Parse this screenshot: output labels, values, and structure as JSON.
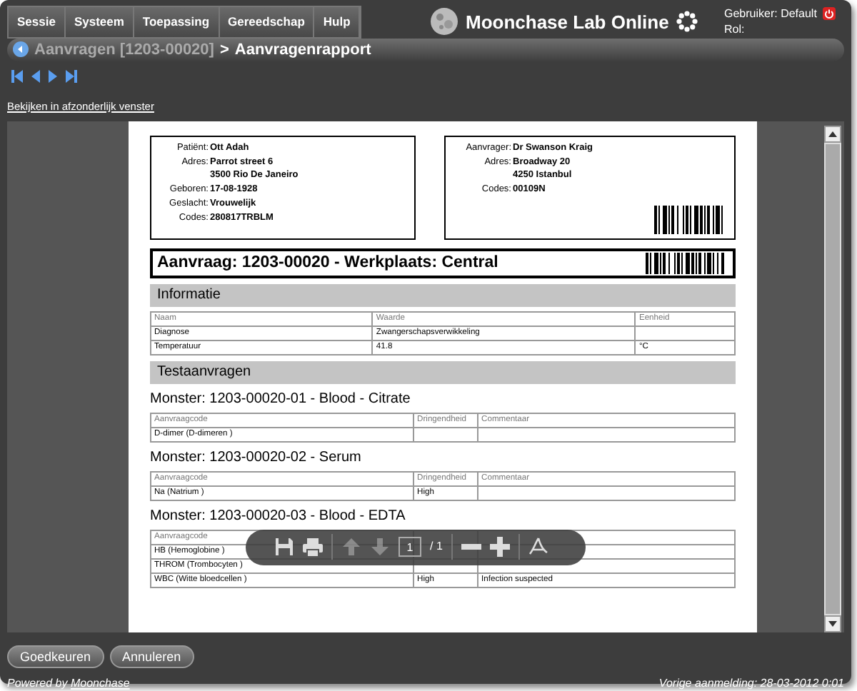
{
  "menu": [
    {
      "label": "Sessie"
    },
    {
      "label": "Systeem"
    },
    {
      "label": "Toepassing"
    },
    {
      "label": "Gereedschap"
    },
    {
      "label": "Hulp"
    }
  ],
  "app_title": "Moonchase Lab Online",
  "user": {
    "label": "Gebruiker:",
    "name": "Default",
    "role_label": "Rol:"
  },
  "breadcrumb": {
    "parent": "Aanvragen [1203-00020]",
    "separator": ">",
    "current": "Aanvragenrapport"
  },
  "open_link": "Bekijken in afzonderlijk venster",
  "report": {
    "patient": [
      {
        "label": "Patiënt:",
        "values": [
          "Ott Adah"
        ]
      },
      {
        "label": "Adres:",
        "values": [
          "Parrot street 6",
          "3500 Rio De Janeiro"
        ]
      },
      {
        "label": "Geboren:",
        "values": [
          "17-08-1928"
        ]
      },
      {
        "label": "Geslacht:",
        "values": [
          "Vrouwelijk"
        ]
      },
      {
        "label": "Codes:",
        "values": [
          "280817TRBLM"
        ]
      }
    ],
    "requester": [
      {
        "label": "Aanvrager:",
        "values": [
          "Dr Swanson Kraig"
        ]
      },
      {
        "label": "Adres:",
        "values": [
          "Broadway 20",
          "4250 Istanbul"
        ]
      },
      {
        "label": "Codes:",
        "values": [
          "00109N"
        ]
      }
    ],
    "title": "Aanvraag: 1203-00020 - Werkplaats: Central",
    "info": {
      "heading": "Informatie",
      "columns": [
        "Naam",
        "Waarde",
        "Eenheid"
      ],
      "rows": [
        [
          "Diagnose",
          "Zwangerschapsverwikkeling"
        ],
        [
          "Temperatuur",
          "41.8",
          "°C"
        ]
      ]
    },
    "tests_heading": "Testaanvragen",
    "samples": [
      {
        "title": "Monster: 1203-00020-01 - Blood - Citrate",
        "columns": [
          "Aanvraagcode",
          "Dringendheid",
          "Commentaar"
        ],
        "rows": [
          [
            "D-dimer (D-dimeren )"
          ]
        ]
      },
      {
        "title": "Monster: 1203-00020-02 - Serum",
        "columns": [
          "Aanvraagcode",
          "Dringendheid",
          "Commentaar"
        ],
        "rows": [
          [
            "Na (Natrium )",
            "High"
          ]
        ]
      },
      {
        "title": "Monster: 1203-00020-03 - Blood - EDTA",
        "columns": [
          "Aanvraagcode"
        ],
        "rows": [
          [
            "HB (Hemoglobine )"
          ],
          [
            "THROM (Trombocyten )"
          ],
          [
            "WBC (Witte bloedcellen )",
            "High",
            "Infection suspected"
          ]
        ]
      }
    ]
  },
  "viewer_toolbar": {
    "tools": [
      {
        "kind": "save",
        "disabled": false
      },
      {
        "kind": "print",
        "disabled": false
      },
      {
        "kind": "up",
        "disabled": true
      },
      {
        "kind": "down",
        "disabled": true
      },
      {
        "kind": "page",
        "disabled": false
      },
      {
        "kind": "zoom-out",
        "disabled": false
      },
      {
        "kind": "zoom-in",
        "disabled": false
      },
      {
        "kind": "acrobat",
        "disabled": false
      }
    ],
    "page": "1",
    "total": "/ 1"
  },
  "buttons": [
    "Goedkeuren",
    "Annuleren"
  ],
  "footer": {
    "powered": "Powered by",
    "link": "Moonchase",
    "last_login": "Vorige aanmelding: 28-03-2012 0:01"
  }
}
